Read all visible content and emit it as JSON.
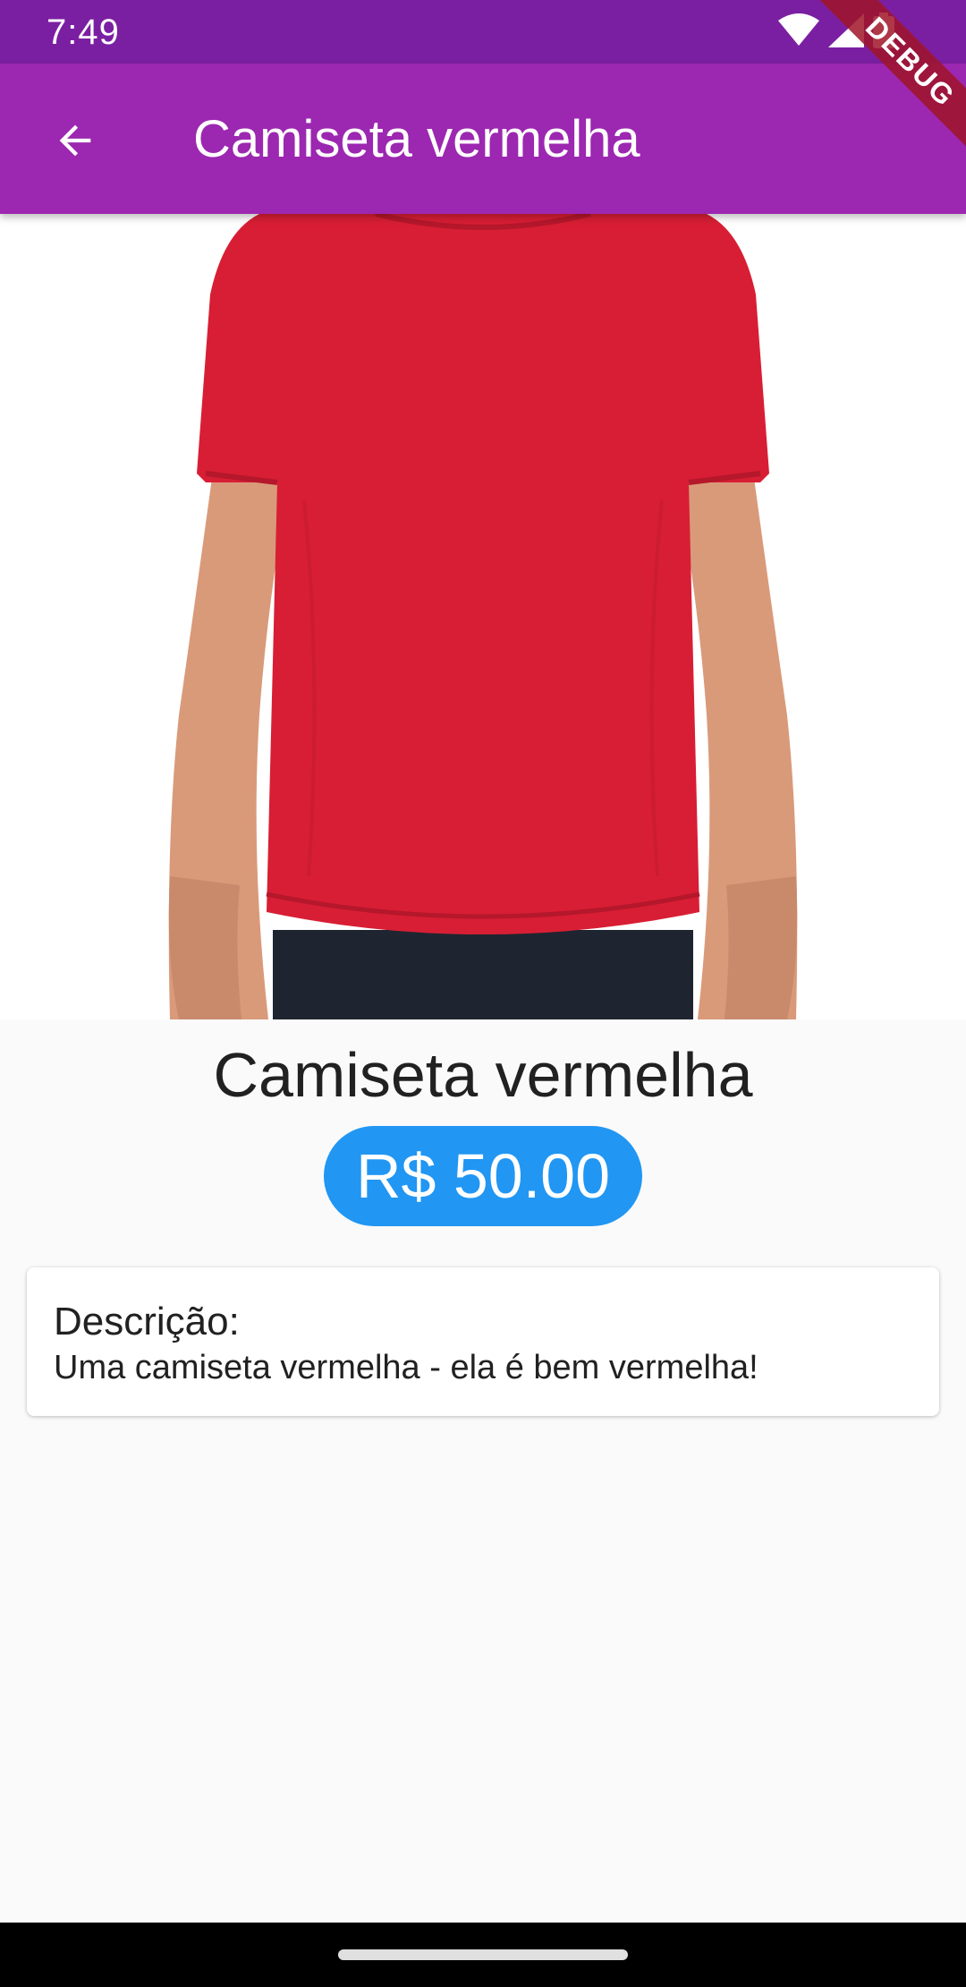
{
  "status_bar": {
    "time": "7:49",
    "icons": [
      "wifi-icon",
      "signal-icon",
      "battery-icon"
    ]
  },
  "app_bar": {
    "title": "Camiseta vermelha",
    "back_icon": "arrow-back-icon",
    "color": "#9c27b0",
    "status_color": "#7b1fa2"
  },
  "debug_banner": {
    "label": "DEBUG"
  },
  "product": {
    "name": "Camiseta vermelha",
    "price": "R$ 50.00",
    "price_color": "#2196f3",
    "shirt_color": "#d81e34"
  },
  "description": {
    "label": "Descrição:",
    "text": "Uma camiseta vermelha - ela é bem vermelha!"
  }
}
